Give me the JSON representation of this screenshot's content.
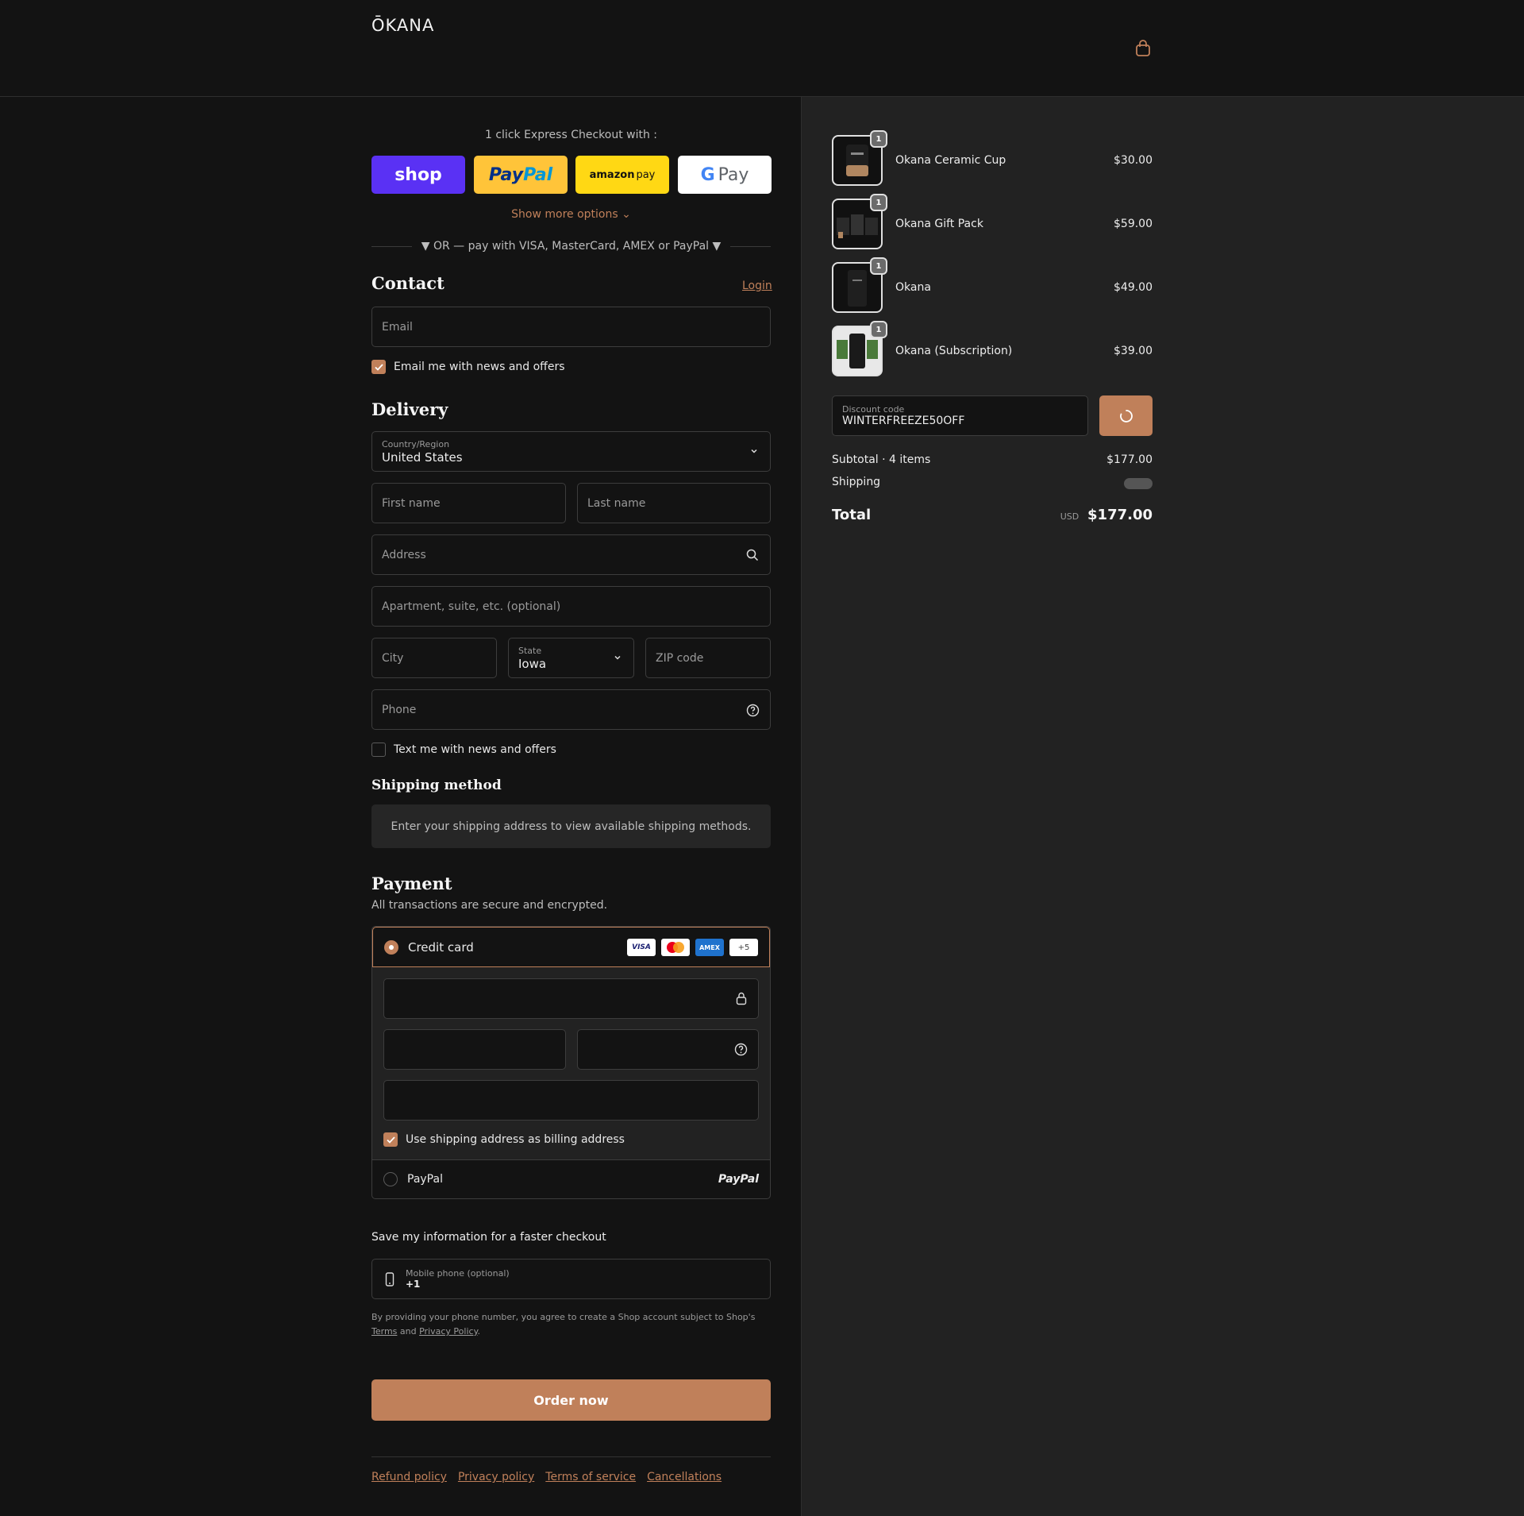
{
  "header": {
    "logo": "ŌKANA"
  },
  "express": {
    "title": "1 click Express Checkout with :",
    "shop_label": "shop",
    "paypal_pay": "Pay",
    "paypal_pal": "Pal",
    "amazon_label": "amazon",
    "amazon_pay": "pay",
    "gpay_g": "G",
    "gpay_label": "Pay",
    "show_more": "Show more options ⌄",
    "or_text": "▼ OR — pay with VISA, MasterCard, AMEX or PayPal ▼"
  },
  "contact": {
    "title": "Contact",
    "login": "Login",
    "email_placeholder": "Email",
    "news_label": "Email me with news and offers",
    "news_checked": true
  },
  "delivery": {
    "title": "Delivery",
    "country_label": "Country/Region",
    "country_value": "United States",
    "first_name": "First name",
    "last_name": "Last name",
    "address": "Address",
    "apartment": "Apartment, suite, etc. (optional)",
    "city": "City",
    "state_label": "State",
    "state_value": "Iowa",
    "zip": "ZIP code",
    "phone": "Phone",
    "text_label": "Text me with news and offers",
    "text_checked": false
  },
  "shipping": {
    "title": "Shipping method",
    "info": "Enter your shipping address to view available shipping methods."
  },
  "payment": {
    "title": "Payment",
    "subtitle": "All transactions are secure and encrypted.",
    "credit_card": "Credit card",
    "card_logos": [
      "VISA",
      "MC",
      "AMEX",
      "+5"
    ],
    "billing_label": "Use shipping address as billing address",
    "paypal": "PayPal",
    "paypal_logo": "PayPal"
  },
  "save": {
    "title": "Save my information for a faster checkout",
    "mobile_label": "Mobile phone (optional)",
    "mobile_value": "+1",
    "legal_prefix": "By providing your phone number, you agree to create a Shop account subject to Shop's",
    "terms": "Terms",
    "and": "and",
    "privacy": "Privacy Policy",
    "period": "."
  },
  "order_button": "Order now",
  "footer": [
    "Refund policy",
    "Privacy policy",
    "Terms of service",
    "Cancellations"
  ],
  "summary": {
    "items": [
      {
        "name": "Okana Ceramic Cup",
        "price": "$30.00",
        "qty": "1"
      },
      {
        "name": "Okana Gift Pack",
        "price": "$59.00",
        "qty": "1"
      },
      {
        "name": "Okana",
        "price": "$49.00",
        "qty": "1"
      },
      {
        "name": "Okana (Subscription)",
        "price": "$39.00",
        "qty": "1"
      }
    ],
    "discount_label": "Discount code",
    "discount_value": "WINTERFREEZE50OFF",
    "subtotal_label": "Subtotal · 4 items",
    "subtotal_value": "$177.00",
    "shipping_label": "Shipping",
    "total_label": "Total",
    "currency": "USD",
    "total_value": "$177.00"
  },
  "colors": {
    "accent": "#c0805a",
    "background": "#131313",
    "panel": "#222222"
  }
}
